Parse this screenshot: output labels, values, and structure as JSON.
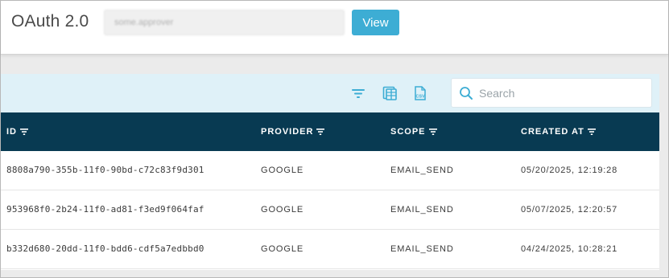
{
  "header": {
    "title": "OAuth 2.0",
    "approver_value": "some.approver",
    "view_label": "View"
  },
  "toolbar": {
    "icons": [
      "filter-icon",
      "columns-icon",
      "csv-export-icon"
    ],
    "search_placeholder": "Search",
    "accent_color": "#3dadd4"
  },
  "table": {
    "columns": [
      {
        "key": "id",
        "label": "ID"
      },
      {
        "key": "provider",
        "label": "PROVIDER"
      },
      {
        "key": "scope",
        "label": "SCOPE"
      },
      {
        "key": "created_at",
        "label": "CREATED AT"
      }
    ],
    "header_color": "#083a52",
    "rows": [
      {
        "id": "8808a790-355b-11f0-90bd-c72c83f9d301",
        "provider": "GOOGLE",
        "scope": "EMAIL_SEND",
        "created_at": "05/20/2025, 12:19:28"
      },
      {
        "id": "953968f0-2b24-11f0-ad81-f3ed9f064faf",
        "provider": "GOOGLE",
        "scope": "EMAIL_SEND",
        "created_at": "05/07/2025, 12:20:57"
      },
      {
        "id": "b332d680-20dd-11f0-bdd6-cdf5a7edbbd0",
        "provider": "GOOGLE",
        "scope": "EMAIL_SEND",
        "created_at": "04/24/2025, 10:28:21"
      }
    ]
  }
}
